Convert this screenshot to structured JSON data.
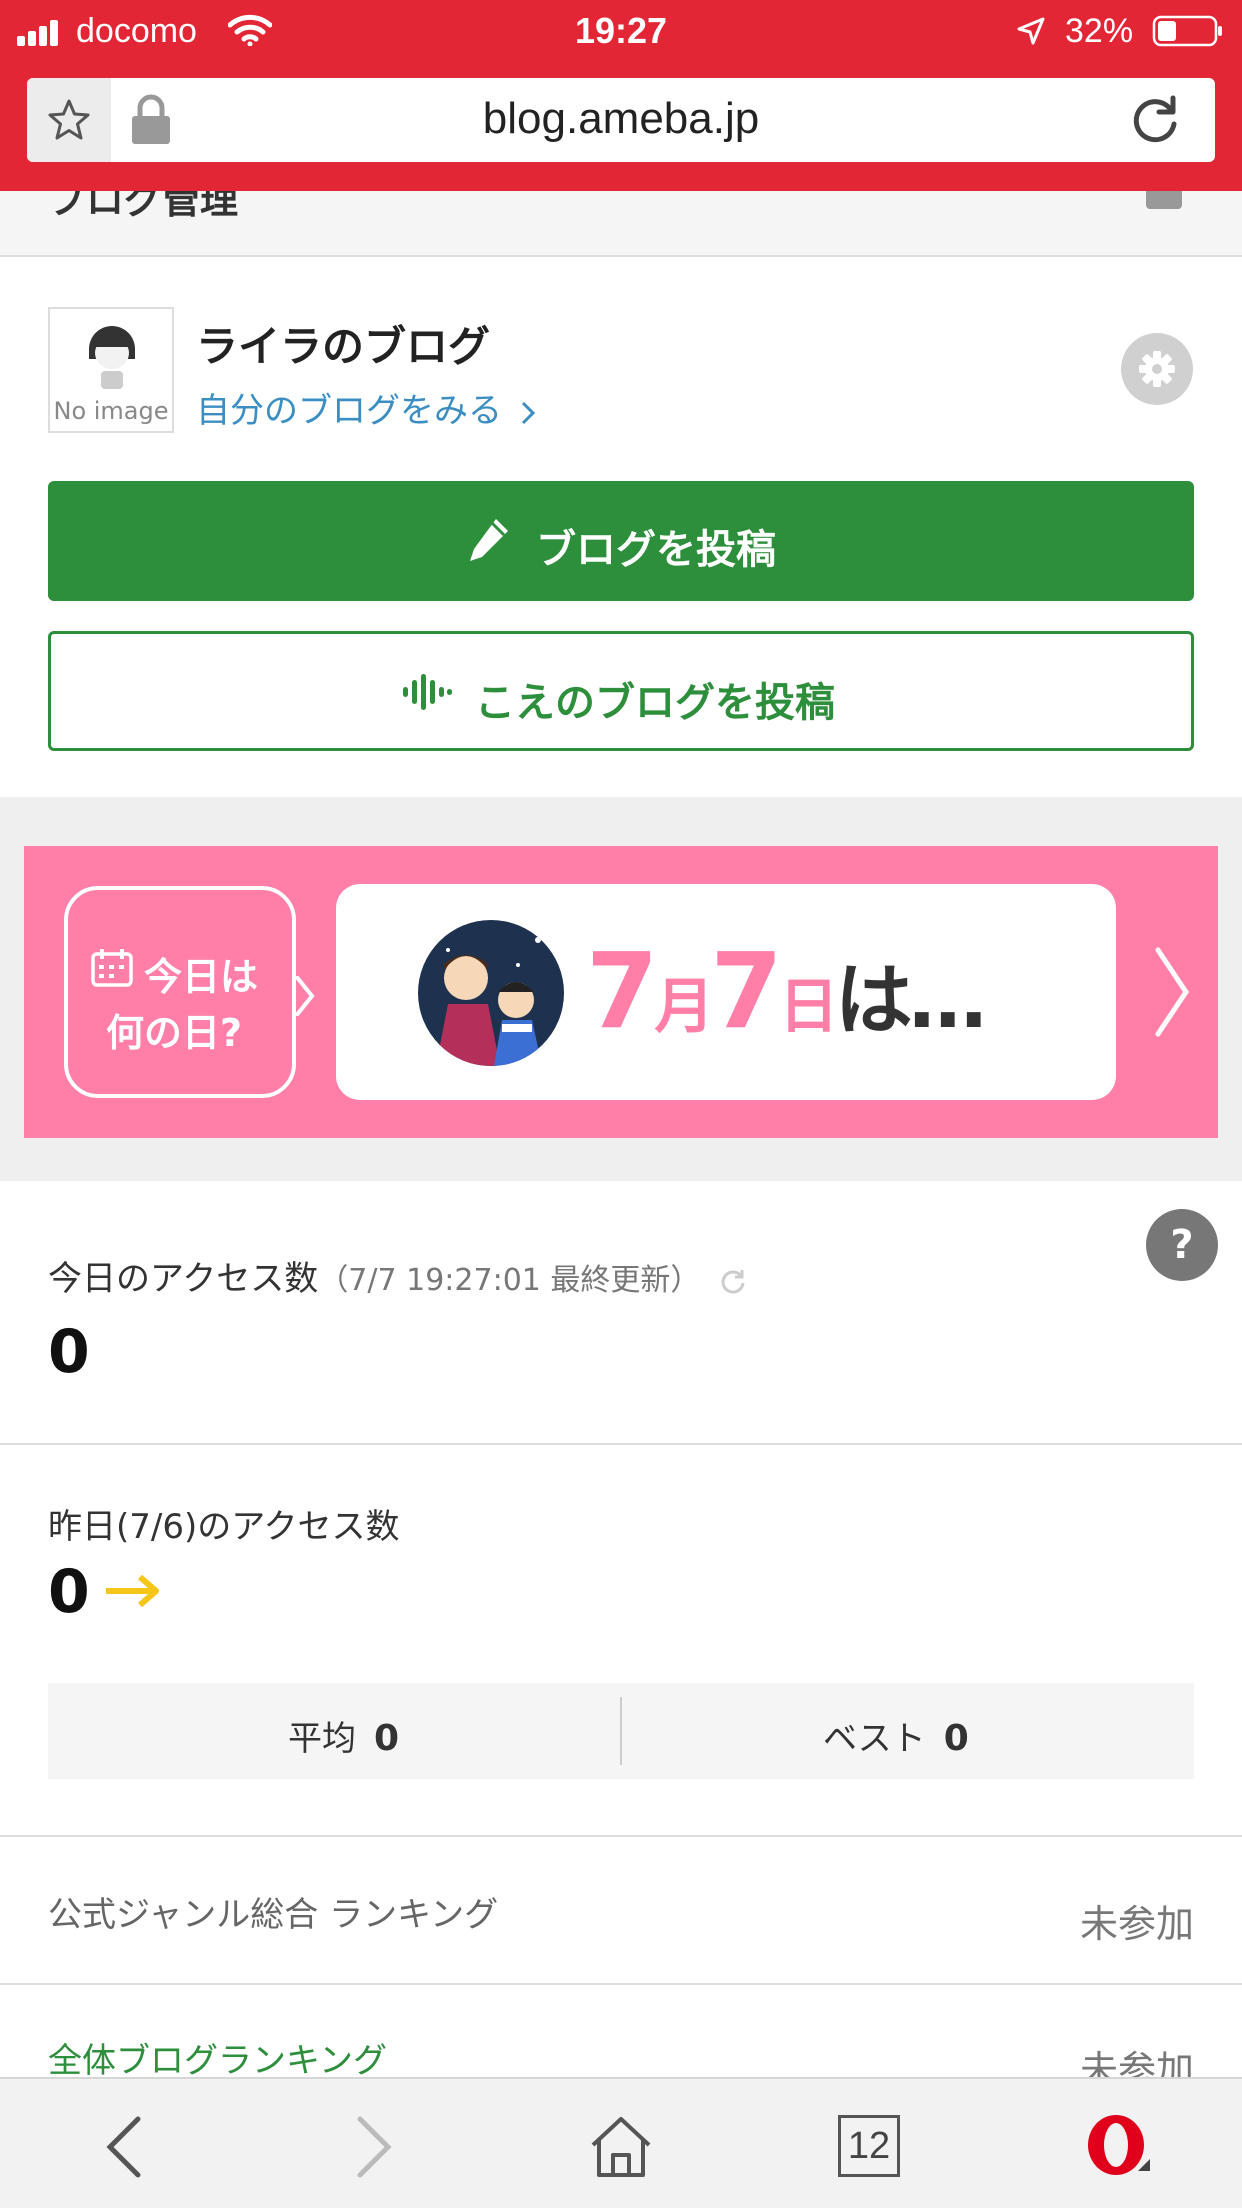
{
  "status_bar": {
    "carrier": "docomo",
    "time": "19:27",
    "battery": "32%"
  },
  "browser": {
    "url": "blog.ameba.jp",
    "tabs_count": "12"
  },
  "page": {
    "header_title": "ブログ管理"
  },
  "profile": {
    "avatar_text": "No image",
    "blog_name": "ライラのブログ",
    "view_link": "自分のブログをみる",
    "post_button": "ブログを投稿",
    "voice_post_button": "こえのブログを投稿"
  },
  "banner": {
    "bubble_line1": "今日は",
    "bubble_line2": "何の日?",
    "month_num": "7",
    "month_char": "月",
    "day_num": "7",
    "day_char": "日",
    "suffix": "は…"
  },
  "access_today": {
    "label": "今日のアクセス数",
    "updated": "（7/7 19:27:01 最終更新）",
    "value": "0",
    "help": "?"
  },
  "access_yesterday": {
    "label": "昨日(7/6)のアクセス数",
    "value": "0",
    "average_label": "平均",
    "average_value": "0",
    "best_label": "ベスト",
    "best_value": "0"
  },
  "rankings": [
    {
      "label": "公式ジャンル総合 ランキング",
      "status": "未参加"
    },
    {
      "label": "全体ブログランキング",
      "status": "未参加"
    }
  ],
  "colors": {
    "browser_red": "#e32636",
    "green": "#2d8e3c",
    "pink": "#ff7fa8",
    "link_blue": "#3b8ec2"
  }
}
